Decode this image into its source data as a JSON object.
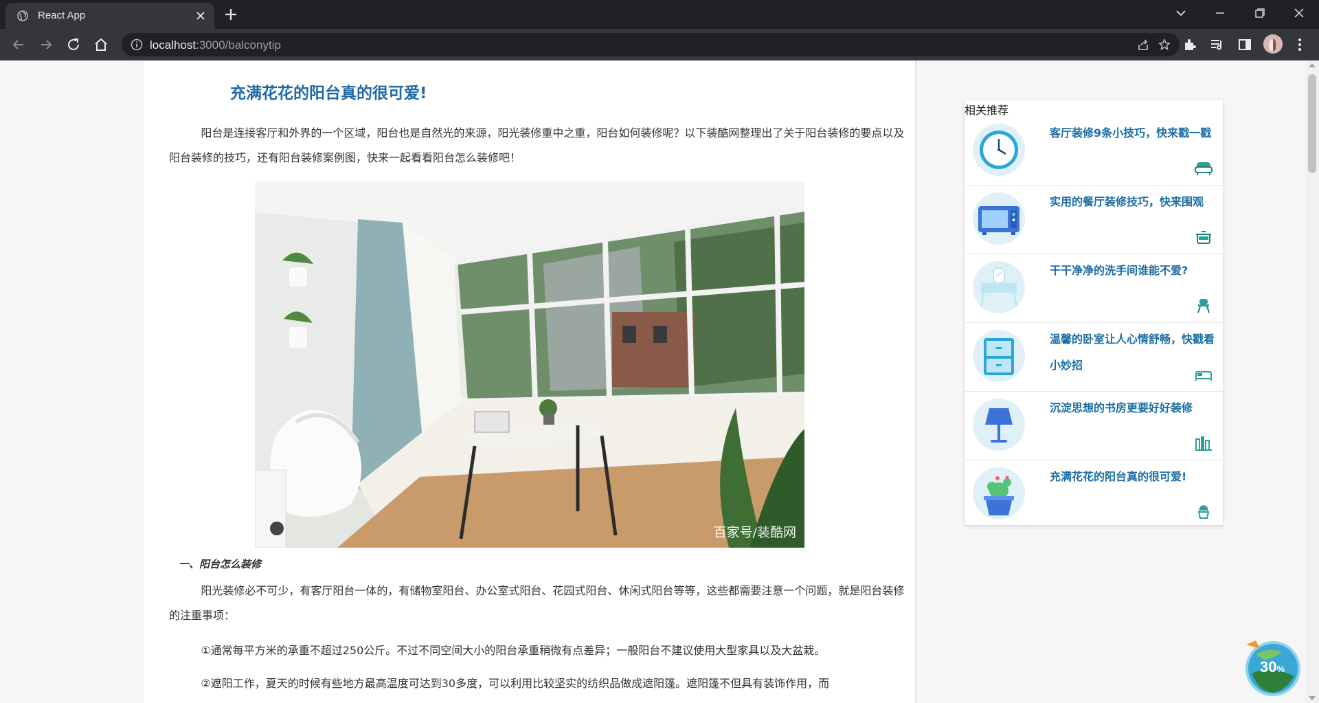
{
  "browser": {
    "tab_title": "React App",
    "url_host": "localhost",
    "url_path": ":3000/balconytip"
  },
  "article": {
    "title": "充满花花的阳台真的很可爱!",
    "intro": "阳台是连接客厅和外界的一个区域，阳台也是自然光的来源，阳光装修重中之重，阳台如何装修呢？以下装酷网整理出了关于阳台装修的要点以及阳台装修的技巧，还有阳台装修案例图，快来一起看看阳台怎么装修吧！",
    "image_watermark": "百家号/装酷网",
    "section1_heading": "一、阳台怎么装修",
    "section1_p1": "阳光装修必不可少，有客厅阳台一体的，有储物室阳台、办公室式阳台、花园式阳台、休闲式阳台等等，这些都需要注意一个问题，就是阳台装修的注重事项：",
    "section1_p2": "①通常每平方米的承重不超过250公斤。不过不同空间大小的阳台承重稍微有点差异；一般阳台不建议使用大型家具以及大盆栽。",
    "section1_p3": "②遮阳工作，夏天的时候有些地方最高温度可达到30多度，可以利用比较坚实的纺织品做成遮阳篷。遮阳篷不但具有装饰作用，而"
  },
  "sidebar": {
    "title": "相关推荐",
    "items": [
      {
        "label": "客厅装修9条小技巧，快来戳一戳",
        "icon": "clock-icon",
        "mini_icon": "sofa-icon"
      },
      {
        "label": "实用的餐厅装修技巧，快来围观",
        "icon": "microwave-icon",
        "mini_icon": "pot-icon"
      },
      {
        "label": "干干净净的洗手间谁能不爱?",
        "icon": "vanity-table-icon",
        "mini_icon": "stool-icon"
      },
      {
        "label": "温馨的卧室让人心情舒畅，快戳看小妙招",
        "icon": "nightstand-icon",
        "mini_icon": "bed-icon"
      },
      {
        "label": "沉淀思想的书房更要好好装修",
        "icon": "lamp-icon",
        "mini_icon": "books-icon"
      },
      {
        "label": "充满花花的阳台真的很可爱!",
        "icon": "cactus-pot-icon",
        "mini_icon": "plant-icon"
      }
    ]
  },
  "widget": {
    "percent": "30",
    "unit": "%"
  },
  "colors": {
    "title_blue": "#1f6aa5",
    "link_blue": "#1c6da3",
    "icon_teal": "#2aa198",
    "circle_bg": "#dff1f6"
  }
}
